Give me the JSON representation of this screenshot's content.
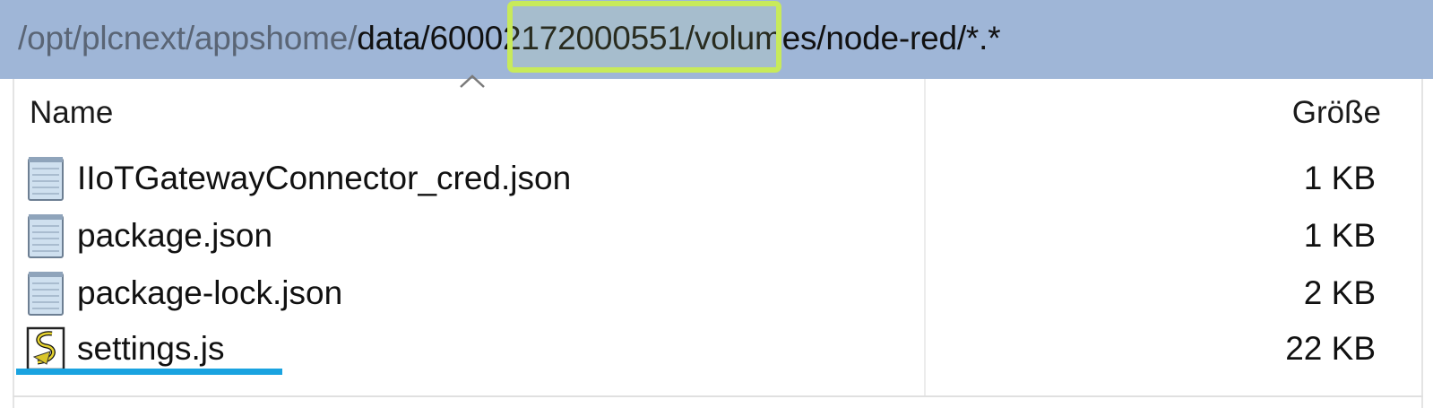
{
  "path_bar": {
    "segments": [
      {
        "text": "/opt/plcnext/appshome/",
        "style": "dim"
      },
      {
        "text": "data/",
        "style": "dark"
      },
      {
        "text": "60002172000551",
        "style": "dark"
      },
      {
        "text": "/",
        "style": "dark"
      },
      {
        "text": "volumes/node-red/*.*",
        "style": "dark"
      }
    ],
    "highlight_color": "#c8ea5a",
    "background_color": "#9fb6d7"
  },
  "columns": {
    "name": "Name",
    "size": "Größe",
    "sort_indicator": "chevron-up-icon"
  },
  "files": [
    {
      "name": "IIoTGatewayConnector_cred.json",
      "size": "1 KB",
      "icon": "notepad-file-icon"
    },
    {
      "name": "package.json",
      "size": "1 KB",
      "icon": "notepad-file-icon"
    },
    {
      "name": "package-lock.json",
      "size": "2 KB",
      "icon": "notepad-file-icon"
    },
    {
      "name": "settings.js",
      "size": "22 KB",
      "icon": "script-file-icon"
    }
  ],
  "annotation": {
    "underline_color": "#1aa3e0"
  }
}
